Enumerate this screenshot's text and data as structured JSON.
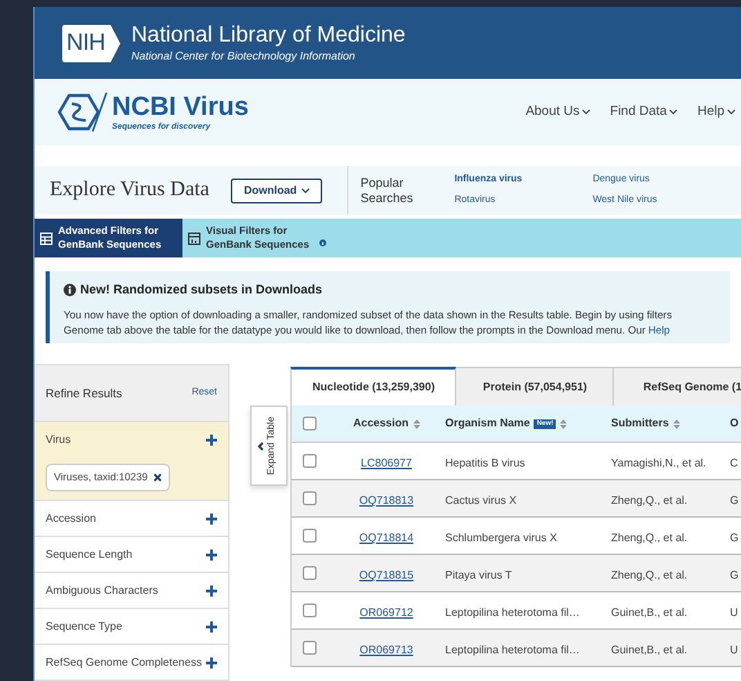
{
  "header": {
    "logo": "NIH",
    "title": "National Library of Medicine",
    "subtitle": "National Center for Biotechnology Information"
  },
  "brand": {
    "name": "NCBI Virus",
    "tagline": "Sequences for discovery"
  },
  "nav": [
    {
      "label": "About Us"
    },
    {
      "label": "Find Data"
    },
    {
      "label": "Help"
    }
  ],
  "explore": {
    "title": "Explore Virus Data",
    "download": "Download",
    "popular_label": "Popular Searches",
    "popular": [
      {
        "label": "Influenza virus",
        "bold": true
      },
      {
        "label": "Dengue virus",
        "bold": false
      },
      {
        "label": "Rotavirus",
        "bold": false
      },
      {
        "label": "West Nile virus",
        "bold": false
      }
    ]
  },
  "filter_tabs": [
    {
      "label": "Advanced Filters for GenBank Sequences",
      "selected": true,
      "info": false
    },
    {
      "label": "Visual Filters for GenBank Sequences",
      "selected": false,
      "info": true
    }
  ],
  "notice": {
    "title": "New! Randomized subsets in Downloads",
    "line_1": "You now have the option of downloading a smaller, randomized subset of the data shown in the Results table. Begin by using filters",
    "line_2": "Genome tab above the table for the datatype you would like to download, then follow the prompts in the Download menu. Our",
    "link": "Help"
  },
  "sidebar": {
    "title": "Refine Results",
    "reset": "Reset",
    "filters": [
      {
        "label": "Virus",
        "active": true,
        "chips": [
          "Viruses, taxid:10239"
        ]
      },
      {
        "label": "Accession",
        "active": false
      },
      {
        "label": "Sequence Length",
        "active": false
      },
      {
        "label": "Ambiguous Characters",
        "active": false
      },
      {
        "label": "Sequence Type",
        "active": false
      },
      {
        "label": "RefSeq Genome Completeness",
        "active": false
      }
    ]
  },
  "expand_tab": "Expand Table",
  "result_tabs": [
    {
      "label": "Nucleotide (13,259,390)",
      "selected": true
    },
    {
      "label": "Protein (57,054,951)",
      "selected": false
    },
    {
      "label": "RefSeq Genome (1",
      "selected": false
    }
  ],
  "table": {
    "all_checked": false,
    "columns": [
      {
        "label": "Accession",
        "sortable": true
      },
      {
        "label": "Organism Name",
        "sortable": true,
        "badge": "New!"
      },
      {
        "label": "Submitters",
        "sortable": true
      },
      {
        "label": "O"
      }
    ],
    "rows": [
      {
        "checked": false,
        "cells": [
          "LC806977",
          "Hepatitis B virus",
          "Yamagishi,N., et al.",
          "C"
        ]
      },
      {
        "checked": false,
        "cells": [
          "OQ718813",
          "Cactus virus X",
          "Zheng,Q., et al.",
          "G"
        ]
      },
      {
        "checked": false,
        "cells": [
          "OQ718814",
          "Schlumbergera virus X",
          "Zheng,Q., et al.",
          "G"
        ]
      },
      {
        "checked": false,
        "cells": [
          "OQ718815",
          "Pitaya virus T",
          "Zheng,Q., et al.",
          "G"
        ]
      },
      {
        "checked": false,
        "cells": [
          "OR069712",
          "Leptopilina heterotoma fil…",
          "Guinet,B., et al.",
          "U"
        ]
      },
      {
        "checked": false,
        "cells": [
          "OR069713",
          "Leptopilina heterotoma fil…",
          "Guinet,B., et al.",
          "U"
        ]
      }
    ]
  }
}
